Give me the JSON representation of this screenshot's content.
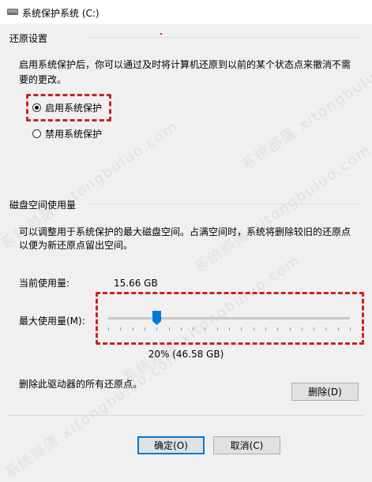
{
  "window": {
    "title": "系统保护系统 (C:)"
  },
  "restore_settings": {
    "heading": "还原设置",
    "description_line1": "启用系统保护后，你可以通过及时将计算机还原到以前的某个状态点来撤消不需",
    "description_line2": "要的更改。",
    "options": [
      {
        "label": "启用系统保护",
        "checked": true
      },
      {
        "label": "禁用系统保护",
        "checked": false
      }
    ]
  },
  "disk_usage": {
    "heading": "磁盘空间使用量",
    "description_line1": "可以调整用于系统保护的最大磁盘空间。占满空间时，系统将删除较旧的还原点",
    "description_line2": "以便为新还原点留出空间。",
    "current_label": "当前使用量:",
    "current_value": "15.66 GB",
    "max_label": "最大使用量(M):",
    "slider_percent": 20,
    "slider_value_text": "20% (46.58 GB)"
  },
  "delete_section": {
    "text": "删除此驱动器的所有还原点。",
    "button_label": "删除(D)"
  },
  "footer": {
    "ok_label": "确定(O)",
    "cancel_label": "取消(C)"
  },
  "watermark_text": "系统部落 xitongbuluo.com",
  "colors": {
    "highlight": "#d11f1f",
    "slider_thumb": "#0078d7",
    "button_border_focus": "#0078d7"
  }
}
